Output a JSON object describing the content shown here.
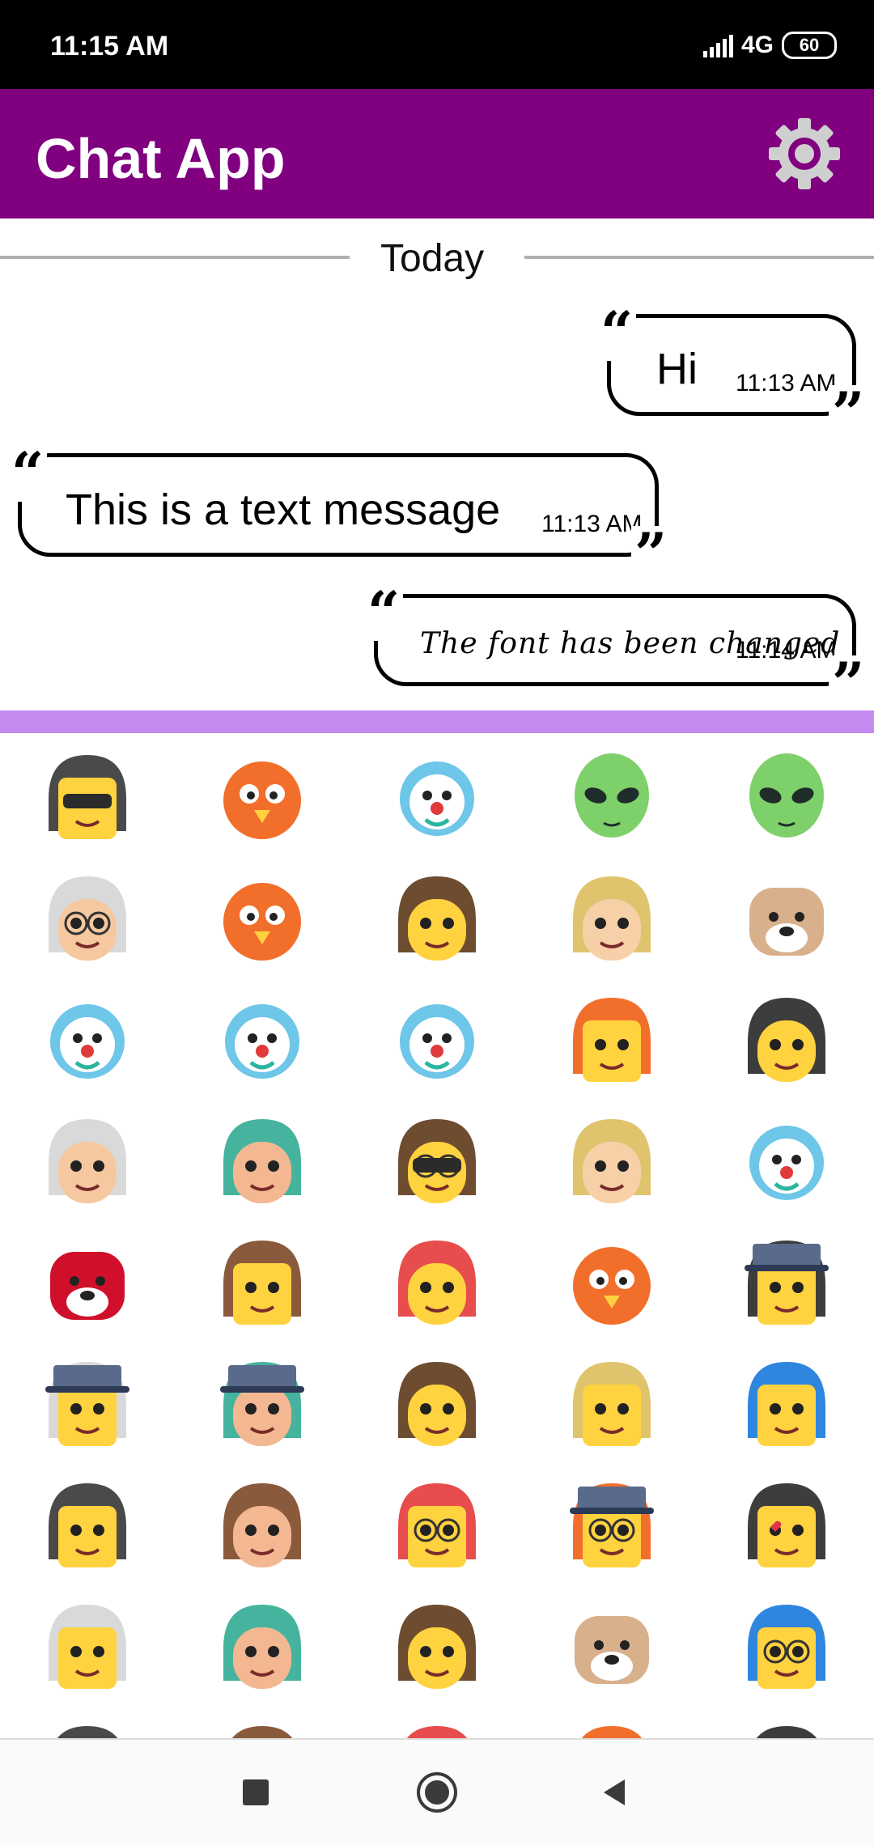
{
  "status_bar": {
    "time": "11:15 AM",
    "network": "4G",
    "battery": "60"
  },
  "app_bar": {
    "title": "Chat App",
    "settings_icon": "gear-icon"
  },
  "chat": {
    "date_separator": "Today",
    "messages": [
      {
        "side": "right",
        "text": "Hi",
        "time": "11:13 AM",
        "style": "normal"
      },
      {
        "side": "left",
        "text": "This is a text message",
        "time": "11:13 AM",
        "style": "normal"
      },
      {
        "side": "right",
        "text": "The font has been changed",
        "time": "11:14 AM",
        "style": "script"
      }
    ]
  },
  "emoji_panel": {
    "accent_color": "#c58af0",
    "emojis": [
      "cool-lego-head-emoji",
      "orange-antenna-creature-emoji",
      "blue-octopus-robot-emoji",
      "green-alien-emoji",
      "three-eyed-alien-emoji",
      "glasses-woman-emoji",
      "angry-bird-emoji",
      "baby-emoji",
      "frog-hood-emoji",
      "bulldog-emoji",
      "teal-hair-clown-emoji",
      "party-clown-emoji",
      "blue-clown-emoji",
      "white-hair-lego-emoji",
      "crying-girl-emoji",
      "one-eyed-boy-emoji",
      "curly-grey-hair-man-emoji",
      "fedora-sunglasses-man-emoji",
      "dragon-mask-emoji",
      "blue-elephant-emoji",
      "red-dog-emoji",
      "winking-kiss-lego-emoji",
      "frankenstein-emoji",
      "orange-fox-emoji",
      "mustache-hat-lego-emoji",
      "top-hat-monocle-lego-emoji",
      "top-hat-monocle-man-emoji",
      "freckled-girl-emoji",
      "screaming-blonde-lego-emoji",
      "bow-girl-lego-emoji",
      "smirking-lego-emoji",
      "laughing-woman-emoji",
      "harry-potter-lego-emoji",
      "glasses-hat-lego-emoji",
      "heart-eyes-lego-emoji",
      "kissing-lego-woman-emoji",
      "blowing-kiss-woman-emoji",
      "pink-hair-kiss-girl-emoji",
      "cat-meowth-emoji",
      "nerd-lego-emoji",
      "owl-emoji",
      "pink-hair-emoji",
      "pirate-emoji",
      "crown-emoji",
      "yellow-emoji"
    ]
  },
  "nav_bar": {
    "recents_icon": "square-icon",
    "home_icon": "circle-icon",
    "back_icon": "triangle-back-icon"
  }
}
